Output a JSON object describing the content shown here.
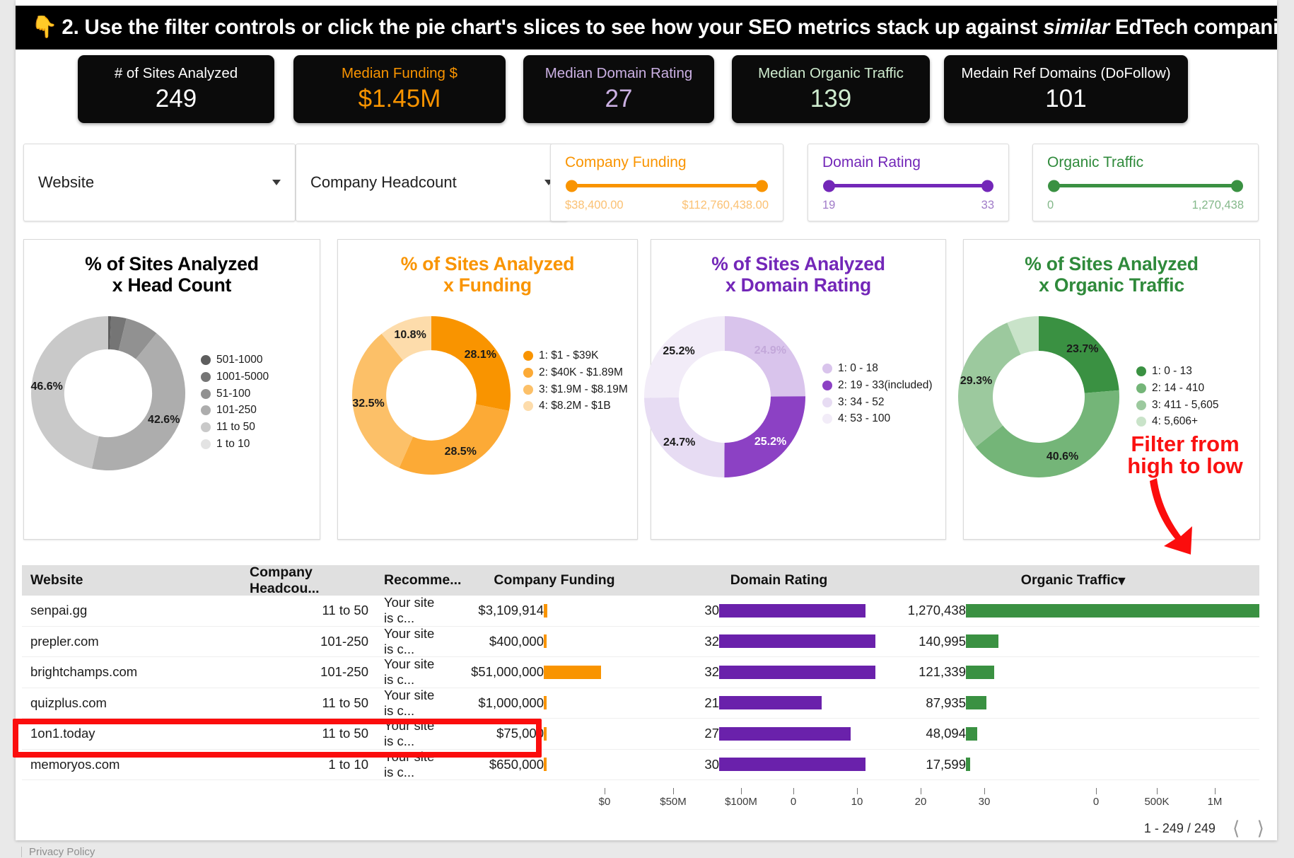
{
  "banner": {
    "icon": "pointing-down-hand-emoji",
    "text_before": "2. Use the filter controls or click the pie chart's slices to see how your SEO metrics stack up against ",
    "text_italic": "similar",
    "text_after": " EdTech companies:"
  },
  "kpis": [
    {
      "title": "# of Sites Analyzed",
      "value": "249",
      "color": "#ffffff"
    },
    {
      "title": "Median Funding $",
      "value": "$1.45M",
      "color": "#f99400"
    },
    {
      "title": "Median Domain Rating",
      "value": "27",
      "color": "#cbb0e3"
    },
    {
      "title": "Median Organic Traffic",
      "value": "139",
      "color": "#cfeccf"
    },
    {
      "title": "Medain Ref Domains (DoFollow)",
      "value": "101",
      "color": "#ffffff"
    }
  ],
  "filters": {
    "dropdowns": [
      {
        "label": "Website",
        "icon": "chevron-down-icon"
      },
      {
        "label": "Company Headcount",
        "icon": "chevron-down-icon"
      }
    ],
    "sliders": [
      {
        "title": "Company Funding",
        "min": "$38,400.00",
        "max": "$112,760,438.00",
        "color": "#f99400"
      },
      {
        "title": "Domain Rating",
        "min": "19",
        "max": "33",
        "color": "#7327b8"
      },
      {
        "title": "Organic Traffic",
        "min": "0",
        "max": "1,270,438",
        "color": "#3a9142"
      }
    ]
  },
  "annotation": {
    "line1": "Filter from",
    "line2": "high to low",
    "color": "#fa1111"
  },
  "chart_data": [
    {
      "type": "pie",
      "title": "% of Sites Analyzed\nx Head Count",
      "title_line1": "% of Sites Analyzed",
      "title_line2": "x Head Count",
      "title_color": "#000000",
      "categories": [
        "501-1000",
        "1001-5000",
        "51-100",
        "101-250",
        "11 to 50",
        "1 to 10"
      ],
      "values": [
        0.6,
        3.2,
        7.0,
        42.6,
        46.6,
        0.0
      ],
      "labels": [
        "",
        "",
        "",
        "42.6%",
        "46.6%",
        ""
      ],
      "colors": [
        "#5e5e5e",
        "#757575",
        "#919191",
        "#adadad",
        "#c9c9c9",
        "#e3e3e3"
      ],
      "legend_position": "right"
    },
    {
      "type": "pie",
      "title_line1": "% of Sites Analyzed",
      "title_line2": "x Funding",
      "title_color": "#f99400",
      "categories": [
        "1: $1 - $39K",
        "2: $40K - $1.89M",
        "3: $1.9M - $8.19M",
        "4: $8.2M - $1B"
      ],
      "values": [
        28.1,
        28.5,
        32.5,
        10.8
      ],
      "labels": [
        "28.1%",
        "28.5%",
        "32.5%",
        "10.8%"
      ],
      "colors": [
        "#f99400",
        "#fcaa36",
        "#fcc068",
        "#fddcab"
      ],
      "legend_position": "right"
    },
    {
      "type": "pie",
      "title_line1": "% of Sites Analyzed",
      "title_line2": "x Domain Rating",
      "title_color": "#7327b8",
      "categories": [
        "1: 0 - 18",
        "2: 19 - 33(included)",
        "3: 34 - 52",
        "4: 53 - 100"
      ],
      "values": [
        24.9,
        25.2,
        24.7,
        25.2
      ],
      "labels": [
        "24.9%",
        "25.2%",
        "24.7%",
        "25.2%"
      ],
      "colors": [
        "#d9c4ec",
        "#8c41c4",
        "#e7dcf3",
        "#f2ecf8"
      ],
      "legend_position": "right"
    },
    {
      "type": "pie",
      "title_line1": "% of Sites Analyzed",
      "title_line2": "x Organic Traffic",
      "title_color": "#2f8a3b",
      "categories": [
        "1: 0 - 13",
        "2: 14 - 410",
        "3: 411 - 5,605",
        "4: 5,606+"
      ],
      "values": [
        23.7,
        40.6,
        29.3,
        6.4
      ],
      "labels": [
        "23.7%",
        "40.6%",
        "29.3%",
        ""
      ],
      "colors": [
        "#3a9142",
        "#74b578",
        "#9cc99e",
        "#c9e3c9"
      ],
      "legend_position": "right"
    }
  ],
  "table": {
    "columns": [
      "Website",
      "Company Headcou...",
      "Recomme...",
      "Company Funding",
      "Domain Rating",
      "Organic Traffic"
    ],
    "sort_column": "Organic Traffic",
    "sort_icon": "caret-down-icon",
    "rows": [
      {
        "website": "senpai.gg",
        "headcount": "11 to 50",
        "recommendation": "Your site is c...",
        "funding": "$3,109,914",
        "funding_pct": 2.8,
        "dr": "30",
        "dr_pct": 90,
        "traffic": "1,270,438",
        "traffic_pct": 100
      },
      {
        "website": "prepler.com",
        "headcount": "101-250",
        "recommendation": "Your site is c...",
        "funding": "$400,000",
        "funding_pct": 0.6,
        "dr": "32",
        "dr_pct": 96,
        "traffic": "140,995",
        "traffic_pct": 11.1
      },
      {
        "website": "brightchamps.com",
        "headcount": "101-250",
        "recommendation": "Your site is c...",
        "funding": "$51,000,000",
        "funding_pct": 45.0,
        "dr": "32",
        "dr_pct": 96,
        "traffic": "121,339",
        "traffic_pct": 9.6
      },
      {
        "website": "quizplus.com",
        "headcount": "11 to 50",
        "recommendation": "Your site is c...",
        "funding": "$1,000,000",
        "funding_pct": 1.1,
        "dr": "21",
        "dr_pct": 63,
        "traffic": "87,935",
        "traffic_pct": 6.9
      },
      {
        "website": "1on1.today",
        "headcount": "11 to 50",
        "recommendation": "Your site is c...",
        "funding": "$75,000",
        "funding_pct": 0.6,
        "dr": "27",
        "dr_pct": 81,
        "traffic": "48,094",
        "traffic_pct": 3.8,
        "highlighted": true
      },
      {
        "website": "memoryos.com",
        "headcount": "1 to 10",
        "recommendation": "Your site is c...",
        "funding": "$650,000",
        "funding_pct": 0.6,
        "dr": "30",
        "dr_pct": 90,
        "traffic": "17,599",
        "traffic_pct": 1.4
      }
    ],
    "axes": {
      "funding_ticks": [
        "$0",
        "$50M",
        "$100M"
      ],
      "dr_ticks": [
        "0",
        "10",
        "20",
        "30"
      ],
      "traffic_ticks": [
        "0",
        "500K",
        "1M"
      ]
    },
    "pagination": {
      "range": "1 - 249 / 249",
      "prev_icon": "chevron-left-icon",
      "next_icon": "chevron-right-icon"
    }
  },
  "footer": {
    "privacy": "Privacy Policy"
  }
}
